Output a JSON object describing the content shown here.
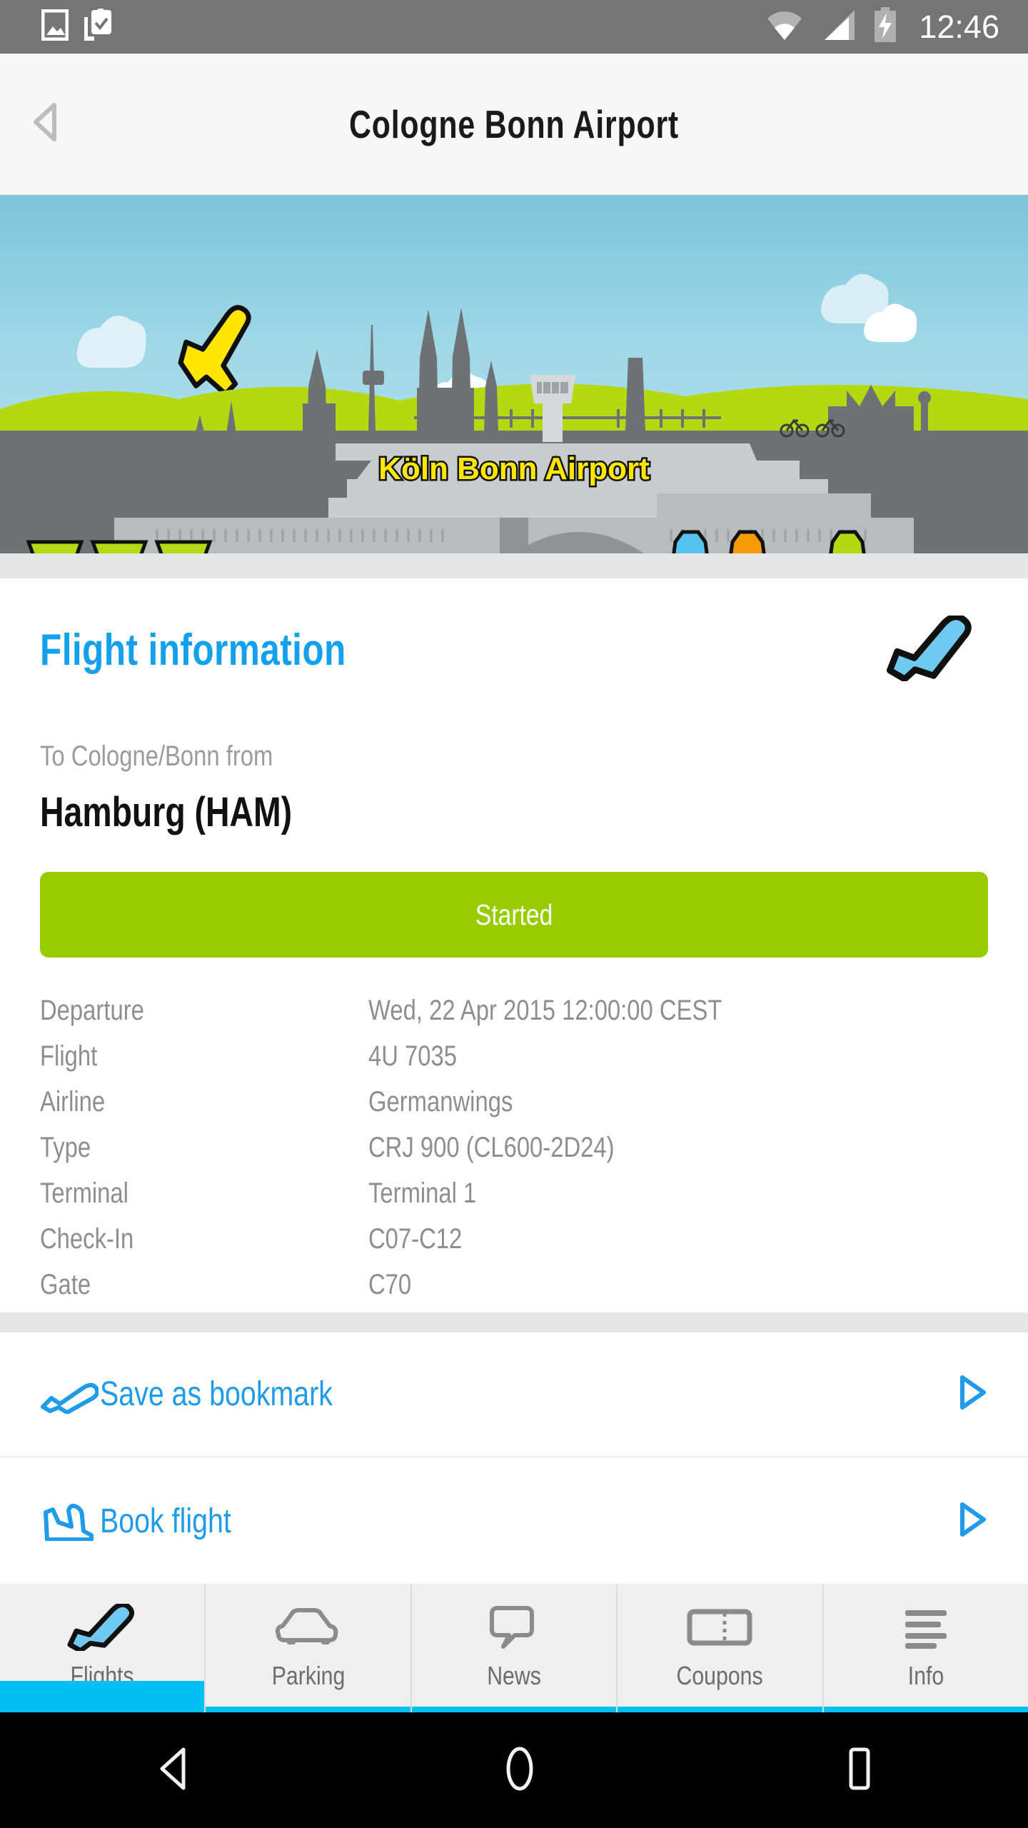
{
  "status_bar": {
    "time": "12:46",
    "icons_left": [
      "image-icon",
      "clipboard-check-icon"
    ],
    "icons_right": [
      "wifi-icon",
      "cellular-signal-icon",
      "battery-charging-icon"
    ]
  },
  "header": {
    "title": "Cologne Bonn Airport",
    "back_icon": "back-arrow-icon"
  },
  "hero": {
    "caption": "Köln Bonn Airport",
    "sky_color": "#9ed7e6",
    "hill_color": "#b4d912",
    "building_color": "#6e7275",
    "plane_color": "#ffe600"
  },
  "flight_info": {
    "heading": "Flight information",
    "heading_color": "#14a0ec",
    "plane_icon": "airplane-arrival-icon",
    "direction_label": "To Cologne/Bonn from",
    "origin": "Hamburg (HAM)",
    "status": "Started",
    "status_color": "#97cc00",
    "details": [
      {
        "label": "Departure",
        "value": "Wed, 22 Apr 2015 12:00:00 CEST"
      },
      {
        "label": "Flight",
        "value": "4U 7035"
      },
      {
        "label": "Airline",
        "value": "Germanwings"
      },
      {
        "label": "Type",
        "value": "CRJ 900 (CL600-2D24)"
      },
      {
        "label": "Terminal",
        "value": "Terminal 1"
      },
      {
        "label": "Check-In",
        "value": "C07-C12"
      },
      {
        "label": "Gate",
        "value": "C70"
      }
    ]
  },
  "actions": [
    {
      "label": "Save as bookmark",
      "icon": "airplane-takeoff-icon",
      "chevron": "chevron-right-icon"
    },
    {
      "label": "Book flight",
      "icon": "airplane-landing-icon",
      "chevron": "chevron-right-icon"
    }
  ],
  "tabs": [
    {
      "label": "Flights",
      "icon": "airplane-icon",
      "active": true
    },
    {
      "label": "Parking",
      "icon": "car-icon",
      "active": false
    },
    {
      "label": "News",
      "icon": "speech-bubble-icon",
      "active": false
    },
    {
      "label": "Coupons",
      "icon": "ticket-icon",
      "active": false
    },
    {
      "label": "Info",
      "icon": "list-lines-icon",
      "active": false
    }
  ],
  "tab_accent_color": "#00c0f3",
  "android_nav": {
    "back": "nav-back-icon",
    "home": "nav-home-icon",
    "recents": "nav-recents-icon"
  }
}
